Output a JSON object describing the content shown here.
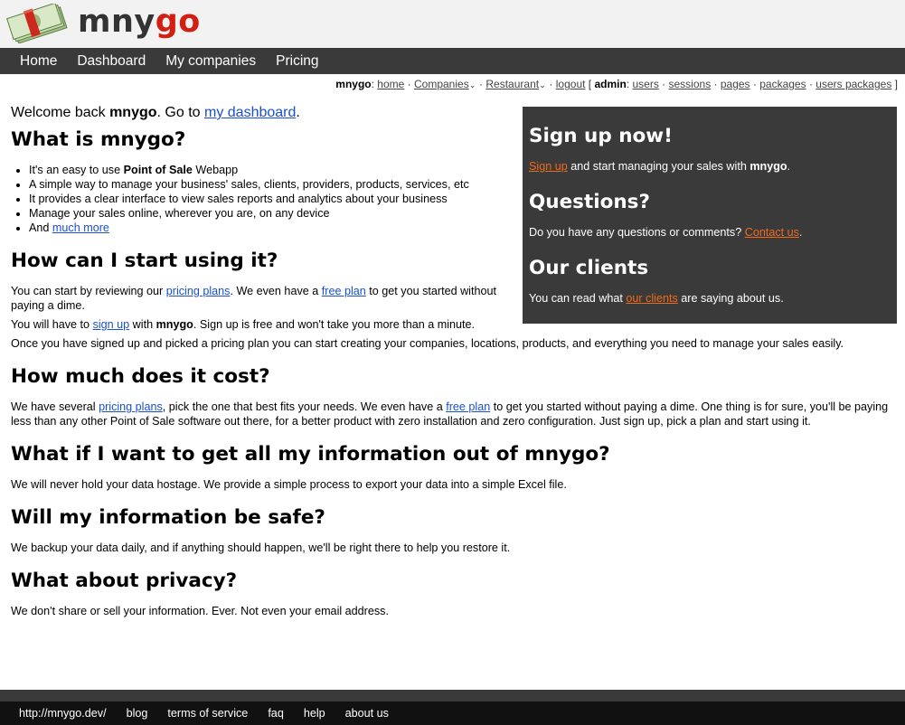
{
  "logo": {
    "icon": "money-stack-icon",
    "text_mny": "mny",
    "text_go": "go"
  },
  "nav": {
    "items": [
      "Home",
      "Dashboard",
      "My companies",
      "Pricing"
    ]
  },
  "userbar": {
    "user": "mnygo",
    "home": "home",
    "companies": "Companies",
    "restaurant": "Restaurant",
    "logout": "logout",
    "admin": "admin",
    "users": "users",
    "sessions": "sessions",
    "pages": "pages",
    "packages": "packages",
    "users_packages": "users packages"
  },
  "welcome": {
    "prefix": "Welcome back ",
    "user": "mnygo",
    "mid": ". Go to ",
    "link": "my dashboard",
    "suffix": "."
  },
  "what_is": {
    "title": "What is mnygo?",
    "item0_prefix": "It's an easy to use ",
    "item0_bold": "Point of Sale",
    "item0_suffix": " Webapp",
    "item1": "A simple way to manage your business' sales, clients, providers, products, services, etc",
    "item2": "It provides a clear interface to view sales reports and analytics about your business",
    "item3": "Manage your sales online, wherever you are, on any device",
    "item4_prefix": "And ",
    "item4_link": "much more"
  },
  "start": {
    "title": "How can I start using it?",
    "p1_a": "You can start by reviewing our ",
    "p1_link1": "pricing plans",
    "p1_b": ". We even have a ",
    "p1_link2": "free plan",
    "p1_c": " to get you started without paying a dime.",
    "p2_a": "You will have to ",
    "p2_link": "sign up",
    "p2_b": " with ",
    "p2_bold": "mnygo",
    "p2_c": ". Sign up is free and won't take you more than a minute.",
    "p3": "Once you have signed up and picked a pricing plan you can start creating your companies, locations, products, and everything you need to manage your sales easily."
  },
  "cost": {
    "title": "How much does it cost?",
    "p_a": "We have several ",
    "p_link1": "pricing plans",
    "p_b": ", pick the one that best fits your needs. We even have a ",
    "p_link2": "free plan",
    "p_c": " to get you started without paying a dime. One thing is for sure, you'll be paying less than any other Point of Sale software out there, for a better product with zero installation and zero configuration. Just sign up, pick a plan and start using it."
  },
  "export": {
    "title": "What if I want to get all my information out of mnygo?",
    "p": "We will never hold your data hostage. We provide a simple process to export your data into a simple Excel file."
  },
  "safe": {
    "title": "Will my information be safe?",
    "p": "We backup your data daily, and if anything should happen, we'll be right there to help you restore it."
  },
  "privacy": {
    "title": "What about privacy?",
    "p": "We don't share or sell your information. Ever. Not even your email address."
  },
  "sidebar": {
    "signup_title": "Sign up now!",
    "signup_link": "Sign up",
    "signup_text": " and start managing your sales with ",
    "signup_bold": "mnygo",
    "signup_end": ".",
    "questions_title": "Questions?",
    "questions_text": "Do you have any questions or comments? ",
    "questions_link": "Contact us",
    "questions_end": ".",
    "clients_title": "Our clients",
    "clients_text": "You can read what ",
    "clients_link": "our clients",
    "clients_end": " are saying about us."
  },
  "footer": {
    "links": [
      "http://mnygo.dev/",
      "blog",
      "terms of service",
      "faq",
      "help",
      "about us"
    ]
  },
  "colors": {
    "nav_bg": "#3a3a3a",
    "logo_red": "#d21f12",
    "sidebar_link": "#f06a1c",
    "link_blue": "#1a4fd0"
  }
}
